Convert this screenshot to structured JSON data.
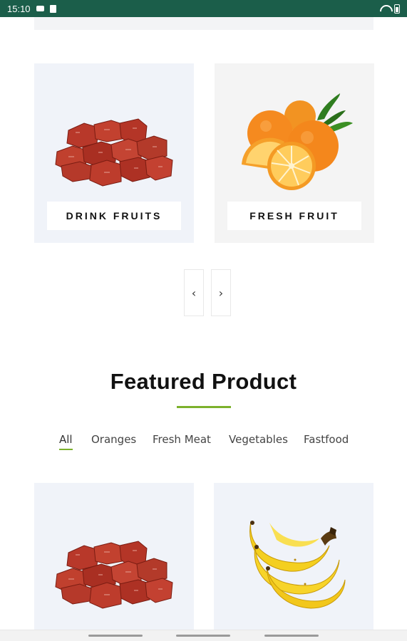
{
  "status_bar": {
    "time": "15:10",
    "left_icons": [
      "video-camera-icon",
      "clipboard-icon"
    ],
    "right_icons": [
      "wifi-icon",
      "battery-icon"
    ],
    "background": "#1b5e4a"
  },
  "categories": {
    "cards": [
      {
        "label": "DRINK FRUITS",
        "image": "meat-cubes-image"
      },
      {
        "label": "FRESH FRUIT",
        "image": "oranges-image"
      }
    ],
    "prev_icon": "chevron-left-icon",
    "next_icon": "chevron-right-icon",
    "prev_glyph": "‹",
    "next_glyph": "›"
  },
  "featured": {
    "title": "Featured Product",
    "accent_color": "#7cb12c",
    "tabs": [
      {
        "label": "All",
        "active": true
      },
      {
        "label": "Oranges",
        "active": false
      },
      {
        "label": "Fresh Meat",
        "active": false
      },
      {
        "label": "Vegetables",
        "active": false
      },
      {
        "label": "Fastfood",
        "active": false
      }
    ],
    "products": [
      {
        "image": "meat-cubes-image"
      },
      {
        "image": "bananas-image"
      }
    ]
  }
}
